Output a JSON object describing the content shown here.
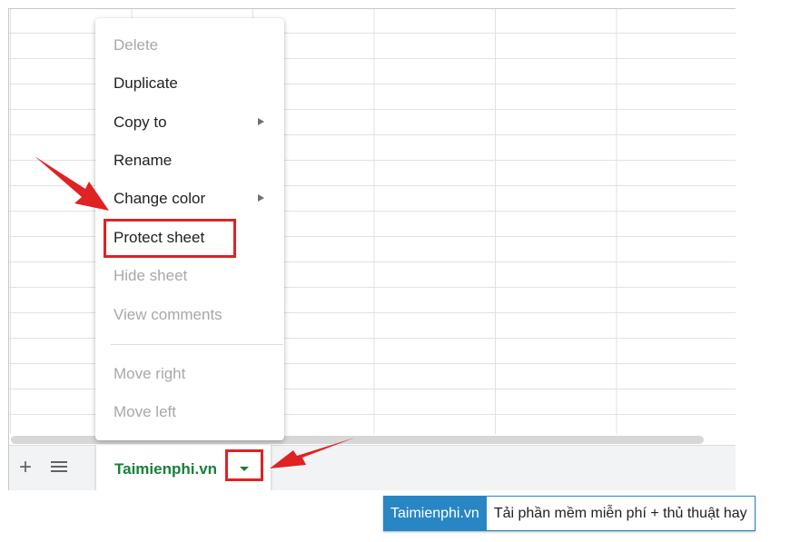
{
  "context_menu": {
    "items": [
      {
        "label": "Delete",
        "disabled": true,
        "submenu": false
      },
      {
        "label": "Duplicate",
        "disabled": false,
        "submenu": false
      },
      {
        "label": "Copy to",
        "disabled": false,
        "submenu": true
      },
      {
        "label": "Rename",
        "disabled": false,
        "submenu": false
      },
      {
        "label": "Change color",
        "disabled": false,
        "submenu": true
      },
      {
        "label": "Protect sheet",
        "disabled": false,
        "submenu": false,
        "highlighted": true
      },
      {
        "label": "Hide sheet",
        "disabled": true,
        "submenu": false
      },
      {
        "label": "View comments",
        "disabled": true,
        "submenu": false
      },
      {
        "label": "Move right",
        "disabled": true,
        "submenu": false
      },
      {
        "label": "Move left",
        "disabled": true,
        "submenu": false
      }
    ]
  },
  "sheet_bar": {
    "add_icon": "plus-icon",
    "list_icon": "all-sheets-icon",
    "active_tab": "Taimienphi.vn",
    "tab_dropdown_icon": "caret-down-icon"
  },
  "footer": {
    "brand": "Taimienphi.vn",
    "tagline": "Tải phần mềm miễn phí + thủ thuật hay"
  },
  "colors": {
    "tab_text": "#188038",
    "highlight": "#e02222",
    "brand_blue": "#2986c4"
  }
}
